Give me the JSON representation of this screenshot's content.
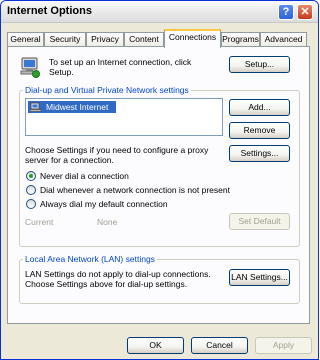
{
  "window": {
    "title": "Internet Options",
    "help_glyph": "?",
    "close_glyph": "✕"
  },
  "tabs": [
    {
      "label": "General"
    },
    {
      "label": "Security"
    },
    {
      "label": "Privacy"
    },
    {
      "label": "Content"
    },
    {
      "label": "Connections"
    },
    {
      "label": "Programs"
    },
    {
      "label": "Advanced"
    }
  ],
  "active_tab": "Connections",
  "setup": {
    "text_line1": "To set up an Internet connection, click",
    "text_line2": "Setup.",
    "button": "Setup..."
  },
  "dialup": {
    "legend": "Dial-up and Virtual Private Network settings",
    "items": [
      {
        "label": "Midwest Internet"
      }
    ],
    "add_button": "Add...",
    "remove_button": "Remove",
    "settings_button": "Settings...",
    "proxy_line1": "Choose Settings if you need to configure a proxy",
    "proxy_line2": "server for a connection.",
    "options": [
      {
        "label": "Never dial a connection",
        "selected": true
      },
      {
        "label": "Dial whenever a network connection is not present",
        "selected": false
      },
      {
        "label": "Always dial my default connection",
        "selected": false
      }
    ],
    "current_label": "Current",
    "current_value": "None",
    "set_default_button": "Set Default"
  },
  "lan": {
    "legend": "Local Area Network (LAN) settings",
    "text_line1": "LAN Settings do not apply to dial-up connections.",
    "text_line2": "Choose Settings above for dial-up settings.",
    "button": "LAN Settings..."
  },
  "footer": {
    "ok": "OK",
    "cancel": "Cancel",
    "apply": "Apply"
  },
  "colors": {
    "accent": "#316AC5",
    "legend": "#0046D5",
    "tab_highlight": "#FFC83C",
    "radio_dot": "#21A121"
  }
}
